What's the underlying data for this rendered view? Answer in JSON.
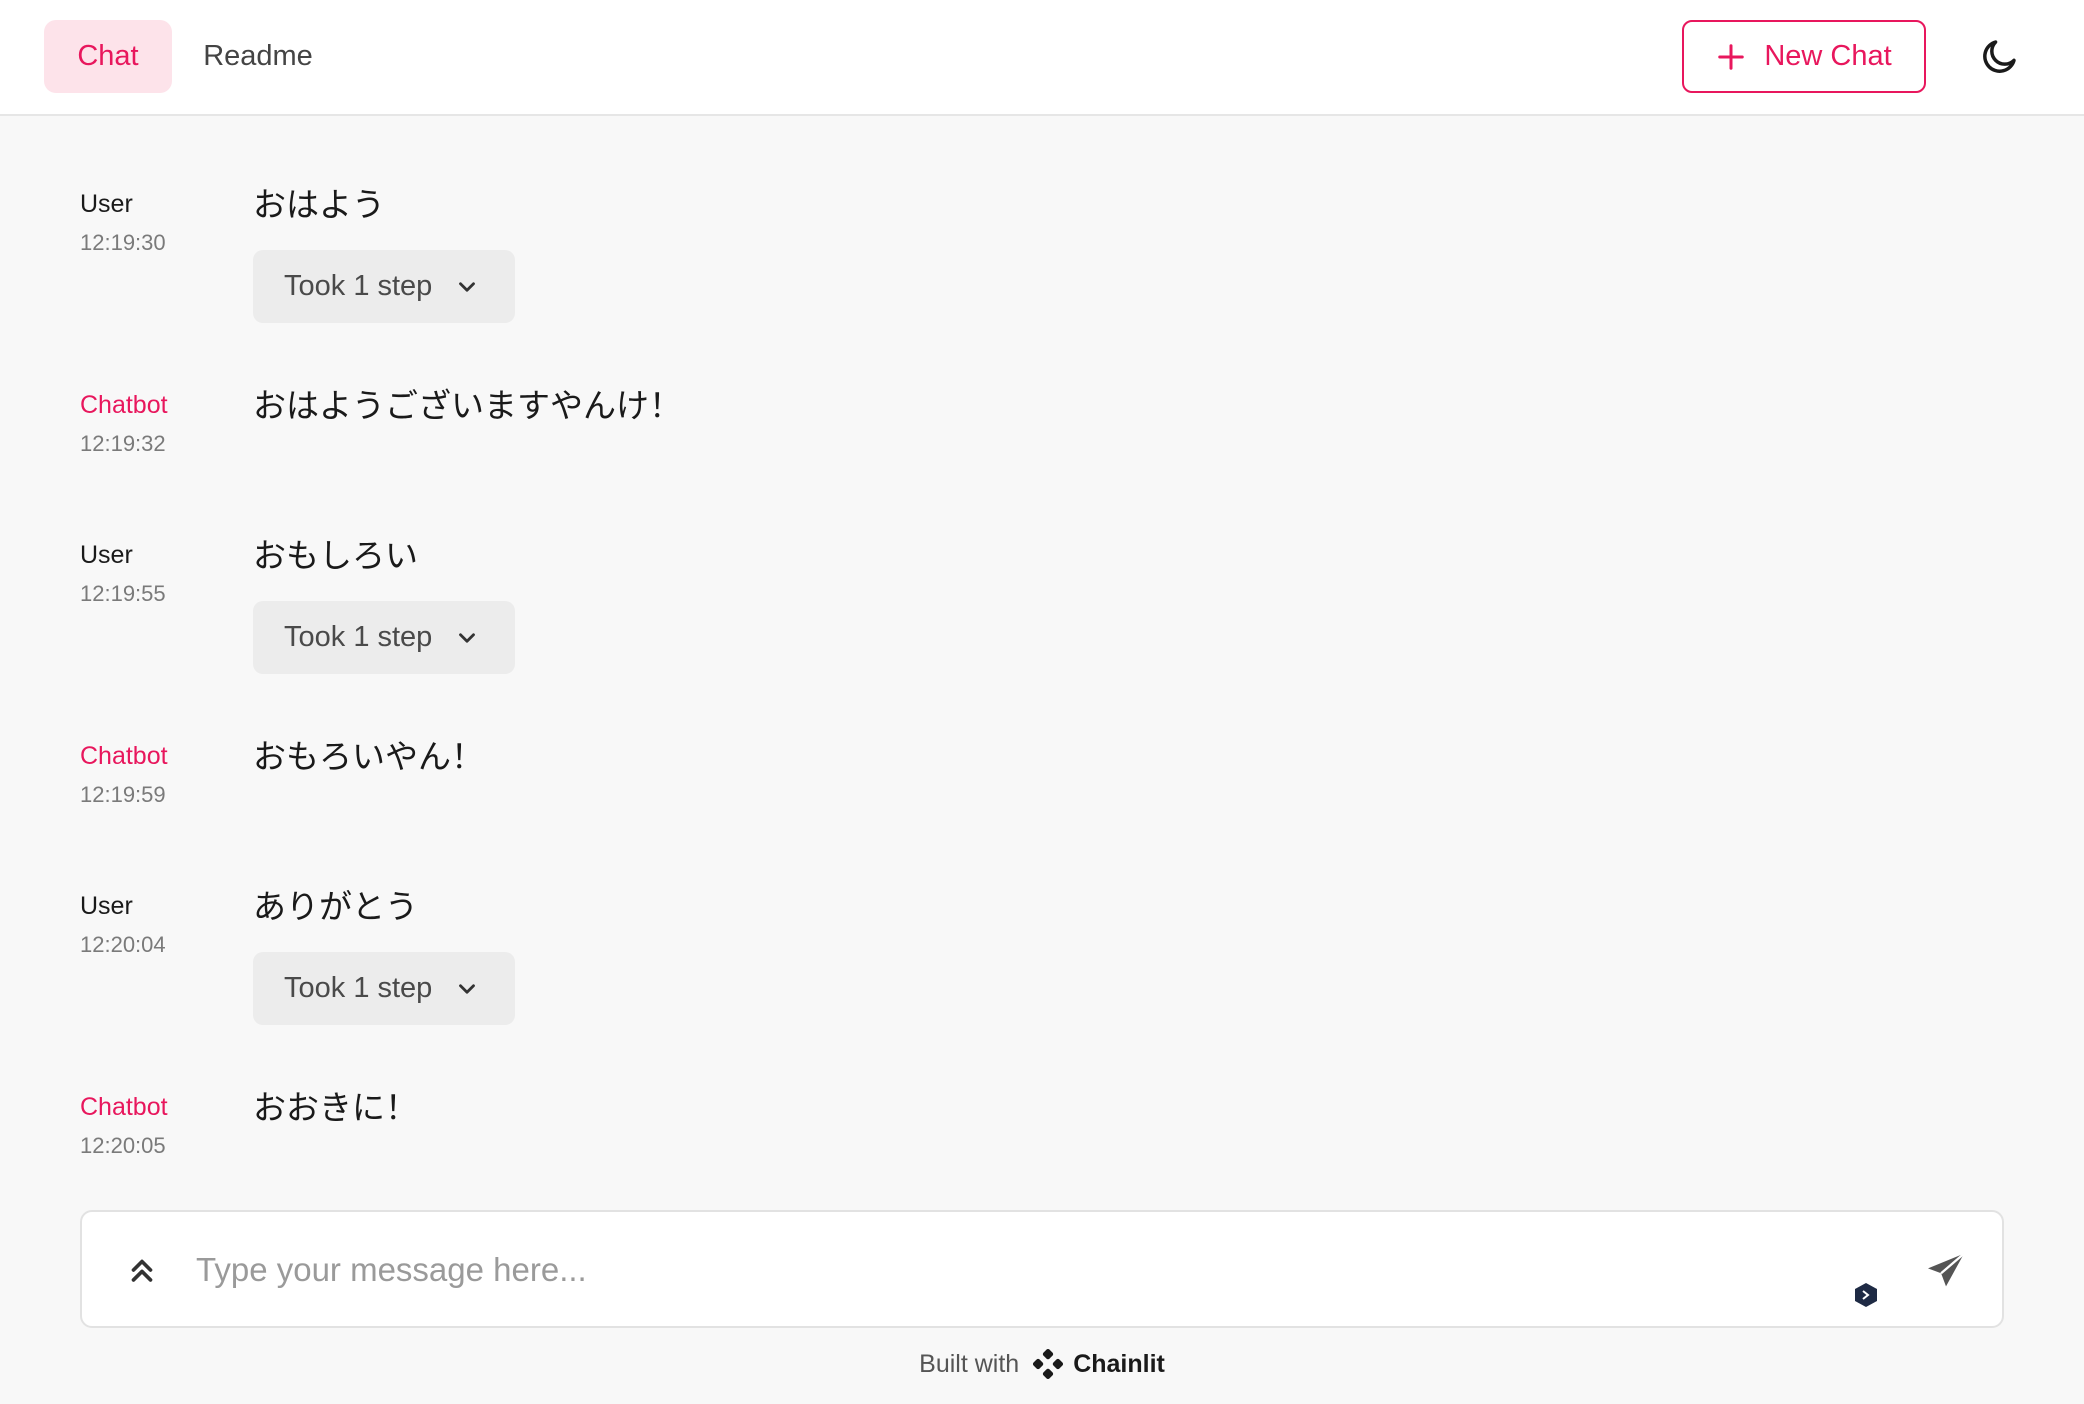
{
  "header": {
    "tabs": [
      {
        "label": "Chat",
        "active": true
      },
      {
        "label": "Readme",
        "active": false
      }
    ],
    "new_chat_label": "New Chat",
    "theme_icon": "moon-icon",
    "accent_color": "#e8175d"
  },
  "messages": [
    {
      "author": "User",
      "time": "12:19:30",
      "text": "おはよう",
      "step_label": "Took 1 step"
    },
    {
      "author": "Chatbot",
      "time": "12:19:32",
      "text": "おはようございますやんけ！"
    },
    {
      "author": "User",
      "time": "12:19:55",
      "text": "おもしろい",
      "step_label": "Took 1 step"
    },
    {
      "author": "Chatbot",
      "time": "12:19:59",
      "text": "おもろいやん！"
    },
    {
      "author": "User",
      "time": "12:20:04",
      "text": "ありがとう",
      "step_label": "Took 1 step"
    },
    {
      "author": "Chatbot",
      "time": "12:20:05",
      "text": "おおきに！"
    }
  ],
  "composer": {
    "placeholder": "Type your message here...",
    "value": ""
  },
  "footer": {
    "built_with": "Built with",
    "brand": "Chainlit"
  }
}
